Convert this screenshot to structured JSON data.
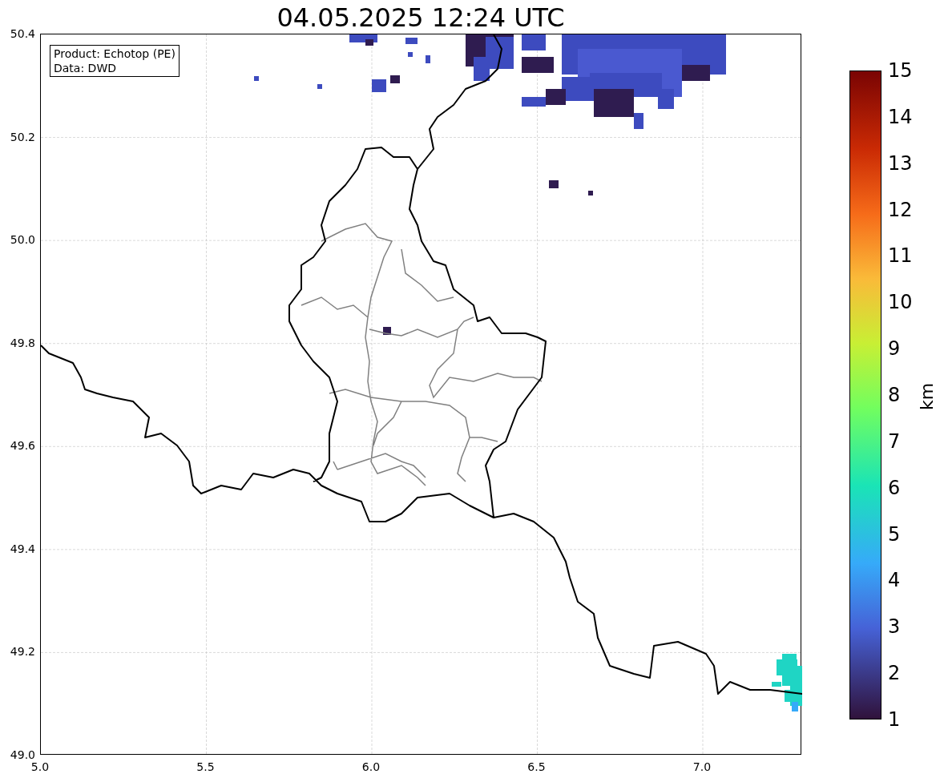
{
  "title": "04.05.2025 12:24 UTC",
  "map": {
    "legend_lines": [
      "Product: Echotop (PE)",
      "Data: DWD"
    ],
    "xticks": [
      "5.0",
      "5.5",
      "6.0",
      "6.5",
      "7.0"
    ],
    "yticks": [
      "50.4",
      "50.2",
      "50.0",
      "49.8",
      "49.6",
      "49.4",
      "49.2",
      "49.0"
    ]
  },
  "colorbar": {
    "label": "km",
    "ticks": [
      "15",
      "14",
      "13",
      "12",
      "11",
      "10",
      "9",
      "8",
      "7",
      "6",
      "5",
      "4",
      "3",
      "2",
      "1"
    ]
  }
}
